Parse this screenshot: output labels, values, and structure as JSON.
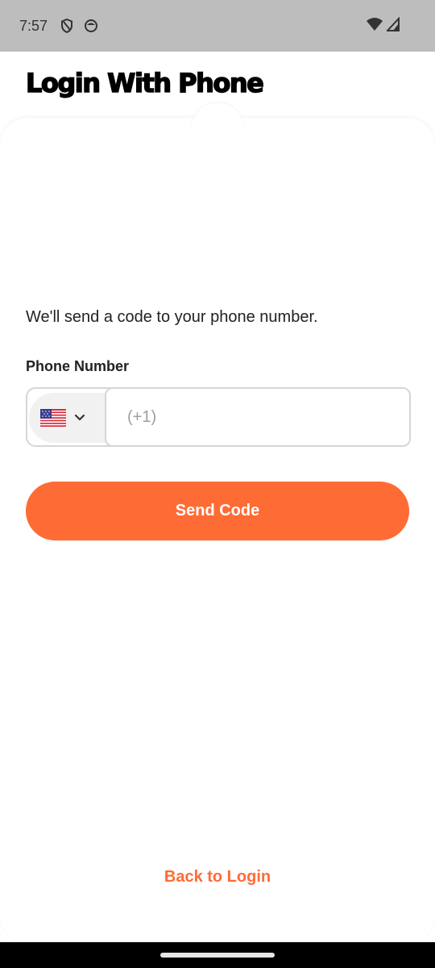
{
  "status_bar": {
    "time": "7:57",
    "icons": [
      "shield-icon",
      "face-icon",
      "wifi-icon",
      "signal-icon"
    ]
  },
  "header": {
    "title": "Login With Phone"
  },
  "form": {
    "instruction": "We'll send a code to your phone number.",
    "phone_label": "Phone Number",
    "country_flag": "us-flag-icon",
    "phone_value": "",
    "phone_placeholder": "(+1)",
    "send_button_label": "Send Code"
  },
  "footer": {
    "back_link_label": "Back to Login"
  },
  "colors": {
    "accent": "#ff6b35",
    "status_bar_bg": "#bdbdbd"
  }
}
